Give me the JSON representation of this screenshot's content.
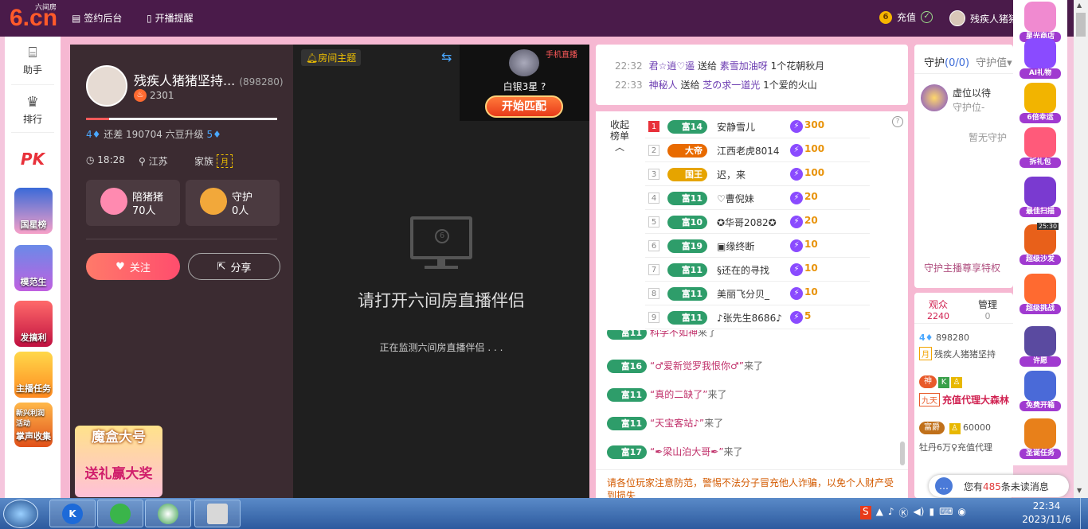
{
  "topbar": {
    "logo_main": "6.cn",
    "logo_sub": "六间房",
    "nav1": "签约后台",
    "nav2": "开播提醒",
    "recharge": "充值",
    "username": "残疾人猪猪"
  },
  "leftnav": {
    "assistant": "助手",
    "rank": "排行",
    "pk": "PK",
    "tiles": [
      "国星榜",
      "模范生",
      "发搞利",
      "主播任务",
      "掌声收集"
    ],
    "tile_new": "新兴利润活动"
  },
  "anchor": {
    "name": "残疾人猪猪坚持...",
    "room_id": "(898280)",
    "fire": "2301",
    "progress_percent": 12,
    "level_text_prefix": "4",
    "level_text": "还差 190704 六豆升级",
    "level_next": "5",
    "time": "18:28",
    "location": "江苏",
    "family_label": "家族",
    "family_tag": "月",
    "companion_label": "陪猪猪",
    "companion_count": "70人",
    "guard_label": "守护",
    "guard_count": "0人",
    "follow": "关注",
    "share": "分享",
    "promo_title": "魔盒大号",
    "promo_sub": "送礼赢大奖"
  },
  "video": {
    "theme": "房间主题",
    "screen_num": "6",
    "title": "请打开六间房直播伴侣",
    "subtitle": "正在监测六间房直播伴侣 . . ."
  },
  "match": {
    "tag": "手机直播",
    "rank_title": "白银3星",
    "question": "?",
    "button": "开始匹配"
  },
  "gifts": [
    {
      "time": "22:32",
      "user": "君☆逍♡遥",
      "action": "送给",
      "target": "素雪加油呀",
      "gift": "1个花朝秋月"
    },
    {
      "time": "22:33",
      "user": "神秘人",
      "action": "送给",
      "target": "芝の求一道光",
      "gift": "1个爱的火山"
    }
  ],
  "rank": {
    "toggle": "收起榜单",
    "help": "?",
    "rows": [
      {
        "num": "1",
        "badge": "富14",
        "name": "安静雪儿",
        "value": "300"
      },
      {
        "num": "2",
        "badge": "大帝",
        "name": "江西老虎8014",
        "value": "100"
      },
      {
        "num": "3",
        "badge": "国王",
        "name": "迟，来",
        "value": "100"
      },
      {
        "num": "4",
        "badge": "富11",
        "name": "♡曹倪妹",
        "value": "20"
      },
      {
        "num": "5",
        "badge": "富10",
        "name": "✪华哥2082✪",
        "value": "20"
      },
      {
        "num": "6",
        "badge": "富19",
        "name": "▣缘终断",
        "value": "10"
      },
      {
        "num": "7",
        "badge": "富11",
        "name": "§还在的寻找",
        "value": "10"
      },
      {
        "num": "8",
        "badge": "富11",
        "name": "美丽飞分贝_",
        "value": "10"
      },
      {
        "num": "9",
        "badge": "富11",
        "name": "♪张先生8686♪",
        "value": "5"
      }
    ]
  },
  "chat": {
    "rows": [
      {
        "badge": "富11",
        "name": "科学不如神",
        "action": "来了"
      },
      {
        "badge": "富16",
        "name": "“♂爱新觉罗我恨你♂”",
        "action": "来了"
      },
      {
        "badge": "富11",
        "name": "“真的二缺了”",
        "action": "来了"
      },
      {
        "badge": "富11",
        "name": "“天宝客站♪”",
        "action": "来了"
      },
      {
        "badge": "富17",
        "name": "“✒梁山泊大哥✒”",
        "action": "来了"
      }
    ],
    "notice": "请各位玩家注意防范，警惕不法分子冒充他人诈骗，以免个人财产受到损失"
  },
  "guard": {
    "tab": "守护",
    "count": "(0/0)",
    "tab2": "守护值",
    "empty_name": "虚位以待",
    "empty_sub": "守护位-",
    "none": "暂无守护",
    "privilege": "守护主播尊享特权"
  },
  "viewers": {
    "tab1": "观众",
    "tab1_count": "2240",
    "tab2": "管理",
    "tab2_count": "0",
    "r1_level": "4",
    "r1_id": "898280",
    "r2_tag": "月",
    "r2_name": "残疾人猪猪坚持",
    "r3_badge": "神",
    "r4_tag": "九天",
    "r4_name": "充值代理大森林",
    "r5_badge": "富爵",
    "r5_value": "60000",
    "r6_name": "牡丹6万♀充值代理"
  },
  "unread": {
    "prefix": "您有",
    "count": "485",
    "suffix": "条未读消息"
  },
  "rightrail": [
    "星光商店",
    "AI礼物",
    "6倍幸运",
    "拆礼包",
    "最佳扫描",
    "超级沙发",
    "超级挑战",
    "许愿",
    "免费开箱",
    "圣诞任务"
  ],
  "rightrail_timer": "25:30",
  "taskbar": {
    "time": "22:34",
    "date": "2023/11/6"
  },
  "colors": {
    "topbar": "#4a1b4a",
    "accent": "#ff4d6d",
    "rich_badge": "#2e9d6a"
  }
}
